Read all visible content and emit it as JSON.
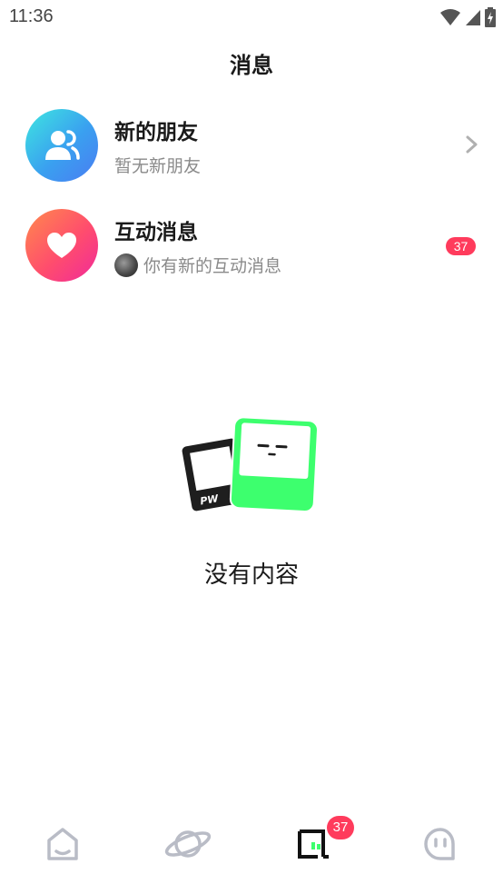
{
  "status_bar": {
    "time": "11:36",
    "icons": [
      "wifi-icon",
      "signal-icon",
      "battery-charging-icon"
    ]
  },
  "header": {
    "title": "消息"
  },
  "messages": [
    {
      "icon": "friends-icon",
      "title": "新的朋友",
      "subtitle": "暂无新朋友",
      "trailing": "chevron-right-icon"
    },
    {
      "icon": "heart-icon",
      "title": "互动消息",
      "subtitle": "你有新的互动消息",
      "badge": "37"
    }
  ],
  "empty_state": {
    "text": "没有内容"
  },
  "bottom_nav": {
    "items": [
      {
        "icon": "home-icon",
        "active": false
      },
      {
        "icon": "planet-icon",
        "active": false
      },
      {
        "icon": "messages-icon",
        "active": true,
        "badge": "37"
      },
      {
        "icon": "profile-face-icon",
        "active": false
      }
    ]
  },
  "colors": {
    "badge": "#ff3b5c",
    "accent_green": "#3dff6e",
    "nav_inactive": "#b9bcc6",
    "text_primary": "#1a1a1a",
    "text_secondary": "#8a8a8a"
  }
}
